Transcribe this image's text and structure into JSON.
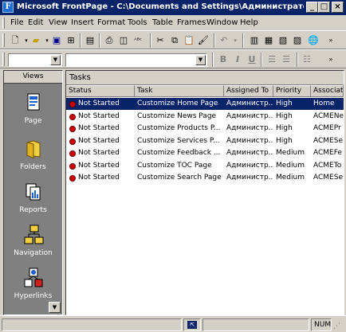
{
  "window": {
    "title": "Microsoft FrontPage - C:\\Documents and Settings\\Администратор\\Мои ...",
    "app_icon": "frontpage-icon",
    "minimize_label": "_",
    "maximize_label": "□",
    "close_label": "×"
  },
  "menu": [
    "File",
    "Edit",
    "View",
    "Insert",
    "Format",
    "Tools",
    "Table",
    "Frames",
    "Window",
    "Help"
  ],
  "toolbar_format": {
    "bold": "B",
    "italic": "I",
    "underline": "U"
  },
  "views": {
    "header": "Views",
    "items": [
      {
        "label": "Page",
        "icon": "page-view-icon"
      },
      {
        "label": "Folders",
        "icon": "folder-view-icon"
      },
      {
        "label": "Reports",
        "icon": "reports-view-icon"
      },
      {
        "label": "Navigation",
        "icon": "navigation-view-icon"
      },
      {
        "label": "Hyperlinks",
        "icon": "hyperlinks-view-icon"
      }
    ],
    "scroll_label": "▼"
  },
  "tasks": {
    "title": "Tasks",
    "columns": [
      "Status",
      "Task",
      "Assigned To",
      "Priority",
      "Associate"
    ],
    "rows": [
      {
        "status": "Not Started",
        "task": "Customize Home Page",
        "assigned": "Администр...",
        "priority": "High",
        "associated": "Home",
        "selected": true
      },
      {
        "status": "Not Started",
        "task": "Customize News Page",
        "assigned": "Администр...",
        "priority": "High",
        "associated": "ACMENe"
      },
      {
        "status": "Not Started",
        "task": "Customize Products P...",
        "assigned": "Администр...",
        "priority": "High",
        "associated": "ACMEPr"
      },
      {
        "status": "Not Started",
        "task": "Customize Services P...",
        "assigned": "Администр...",
        "priority": "High",
        "associated": "ACMESe"
      },
      {
        "status": "Not Started",
        "task": "Customize Feedback ...",
        "assigned": "Администр...",
        "priority": "Medium",
        "associated": "ACMEFe"
      },
      {
        "status": "Not Started",
        "task": "Customize TOC Page",
        "assigned": "Администр...",
        "priority": "Medium",
        "associated": "ACMETo"
      },
      {
        "status": "Not Started",
        "task": "Customize Search Page",
        "assigned": "Администр...",
        "priority": "Medium",
        "associated": "ACMESe"
      }
    ]
  },
  "statusbar": {
    "indicator": "NUM"
  },
  "colors": {
    "titlebar": "#0a246a",
    "selection": "#0a246a",
    "status_dot": "#d10000"
  }
}
